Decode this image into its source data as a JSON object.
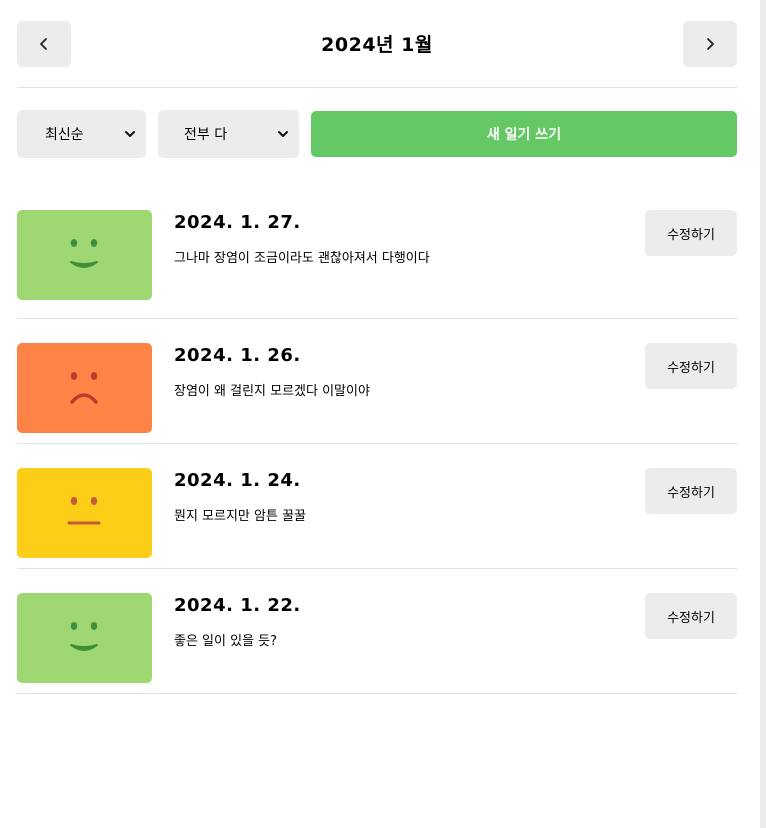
{
  "header": {
    "title": "2024년 1월",
    "prev_icon": "chevron-left-icon",
    "next_icon": "chevron-right-icon"
  },
  "toolbar": {
    "sort_selected": "최신순",
    "filter_selected": "전부 다",
    "new_button_label": "새 일기 쓰기",
    "accent_color": "#64c964"
  },
  "diaries": [
    {
      "date": "2024. 1. 27.",
      "content": "그나마 장염이 조금이라도 괜찮아져서 다행이다",
      "emotion": "smile-face-icon",
      "color": "#9fd872",
      "edit_label": "수정하기"
    },
    {
      "date": "2024. 1. 26.",
      "content": "장염이 왜 걸린지 모르겠다 이말이야",
      "emotion": "sad-face-icon",
      "color": "#fd8446",
      "edit_label": "수정하기"
    },
    {
      "date": "2024. 1. 24.",
      "content": "뭔지 모르지만 암튼 꿀꿀",
      "emotion": "neutral-face-icon",
      "color": "#fdce17",
      "edit_label": "수정하기"
    },
    {
      "date": "2024. 1. 22.",
      "content": "좋은 일이 있을 듯?",
      "emotion": "smile-face-icon",
      "color": "#9fd872",
      "edit_label": "수정하기"
    }
  ]
}
